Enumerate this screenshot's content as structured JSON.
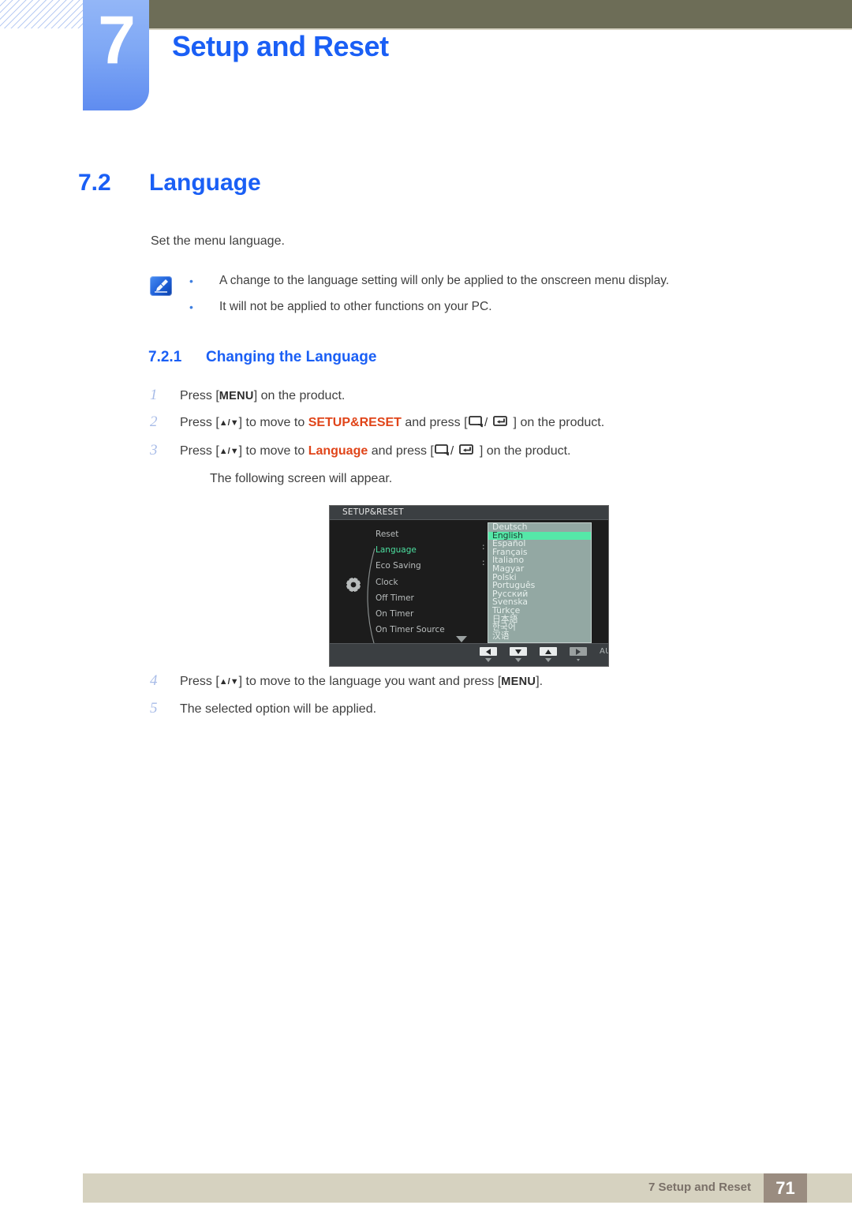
{
  "header": {
    "chapter_number": "7",
    "chapter_title": "Setup and Reset"
  },
  "section": {
    "number": "7.2",
    "name": "Language"
  },
  "intro": "Set the menu language.",
  "note": {
    "icon": "note-pen-icon",
    "bullets": [
      "A change to the language setting will only be applied to the onscreen menu display.",
      "It will not be applied to other functions on your PC."
    ]
  },
  "subsection": {
    "number": "7.2.1",
    "name": "Changing the Language"
  },
  "steps_before": [
    {
      "num": "1",
      "parts": [
        {
          "t": "Press [",
          "k": "plain"
        },
        {
          "t": "MENU",
          "k": "kbd"
        },
        {
          "t": "] on the product.",
          "k": "plain"
        }
      ]
    },
    {
      "num": "2",
      "parts": [
        {
          "t": "Press [",
          "k": "plain"
        },
        {
          "t": "▲/▼",
          "k": "arrows"
        },
        {
          "t": "] to move to ",
          "k": "plain"
        },
        {
          "t": "SETUP&RESET",
          "k": "hl"
        },
        {
          "t": " and press [",
          "k": "plain"
        },
        {
          "t": "",
          "k": "glyphkeys"
        },
        {
          "t": "] on the product.",
          "k": "plain"
        }
      ]
    },
    {
      "num": "3",
      "parts": [
        {
          "t": "Press [",
          "k": "plain"
        },
        {
          "t": "▲/▼",
          "k": "arrows"
        },
        {
          "t": "] to move to ",
          "k": "plain"
        },
        {
          "t": "Language",
          "k": "hl"
        },
        {
          "t": " and press [",
          "k": "plain"
        },
        {
          "t": "",
          "k": "glyphkeys"
        },
        {
          "t": "] on the product.",
          "k": "plain"
        }
      ]
    }
  ],
  "step3_continuation": "The following screen will appear.",
  "steps_after": [
    {
      "num": "4",
      "parts": [
        {
          "t": "Press [",
          "k": "plain"
        },
        {
          "t": "▲/▼",
          "k": "arrows"
        },
        {
          "t": "] to move to the language you want and press [",
          "k": "plain"
        },
        {
          "t": "MENU",
          "k": "kbd"
        },
        {
          "t": "].",
          "k": "plain"
        }
      ]
    },
    {
      "num": "5",
      "parts": [
        {
          "t": "The selected option will be applied.",
          "k": "plain"
        }
      ]
    }
  ],
  "osd": {
    "title": "SETUP&RESET",
    "menu_items": [
      {
        "label": "Reset",
        "active": false,
        "colon": false
      },
      {
        "label": "Language",
        "active": true,
        "colon": true
      },
      {
        "label": "Eco Saving",
        "active": false,
        "colon": true
      },
      {
        "label": "Clock",
        "active": false,
        "colon": false
      },
      {
        "label": "Off Timer",
        "active": false,
        "colon": false
      },
      {
        "label": "On Timer",
        "active": false,
        "colon": false
      },
      {
        "label": "On Timer Source",
        "active": false,
        "colon": false
      }
    ],
    "languages": [
      {
        "label": "Deutsch",
        "selected": false
      },
      {
        "label": "English",
        "selected": true
      },
      {
        "label": "Español",
        "selected": false
      },
      {
        "label": "Français",
        "selected": false
      },
      {
        "label": "Italiano",
        "selected": false
      },
      {
        "label": "Magyar",
        "selected": false
      },
      {
        "label": "Polski",
        "selected": false
      },
      {
        "label": "Português",
        "selected": false
      },
      {
        "label": "Русский",
        "selected": false
      },
      {
        "label": "Svenska",
        "selected": false
      },
      {
        "label": "Türkçe",
        "selected": false
      },
      {
        "label": "日本語",
        "selected": false
      },
      {
        "label": "한국어",
        "selected": false
      },
      {
        "label": "汉语",
        "selected": false
      }
    ],
    "buttons": {
      "auto_label": "AUTO",
      "power_glyph": "⏻"
    },
    "colors": {
      "highlight": "#55e8a8",
      "active_text": "#4ce0a0",
      "lang_panel": "#93a8a3"
    }
  },
  "footer": {
    "text": "7 Setup and Reset",
    "page": "71"
  },
  "theme": {
    "accent_blue": "#1a5ff5",
    "highlight_orange": "#e0451a",
    "header_olive": "#6d6d57",
    "footer_beige": "#d6d2c0",
    "page_box": "#9a8c80"
  }
}
